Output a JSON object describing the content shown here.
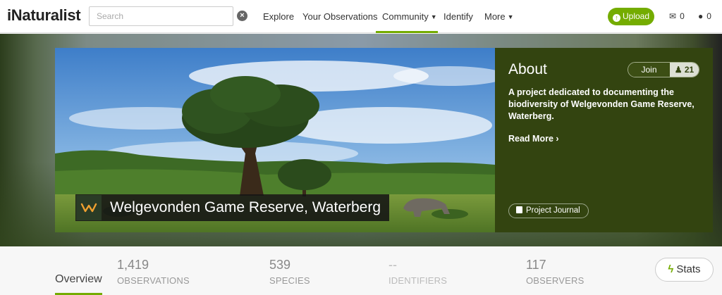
{
  "header": {
    "logo": "iNaturalist",
    "search_placeholder": "Search",
    "nav": {
      "explore": "Explore",
      "your_observations": "Your Observations",
      "community": "Community",
      "identify": "Identify",
      "more": "More"
    },
    "upload_label": "Upload",
    "messages_count": "0",
    "notifications_count": "0"
  },
  "project": {
    "title": "Welgevonden Game Reserve, Waterberg",
    "about_heading": "About",
    "join_label": "Join",
    "members_count": "21",
    "description": "A project dedicated to documenting the biodiversity of Welgevonden Game Reserve, Waterberg.",
    "read_more": "Read More",
    "journal_label": "Project Journal"
  },
  "stats": {
    "overview_tab": "Overview",
    "observations": {
      "value": "1,419",
      "label": "OBSERVATIONS"
    },
    "species": {
      "value": "539",
      "label": "SPECIES"
    },
    "identifiers": {
      "value": "--",
      "label": "IDENTIFIERS"
    },
    "observers": {
      "value": "117",
      "label": "OBSERVERS"
    },
    "stats_button": "Stats"
  },
  "colors": {
    "brand_green": "#74ac00",
    "about_bg": "#334410"
  }
}
